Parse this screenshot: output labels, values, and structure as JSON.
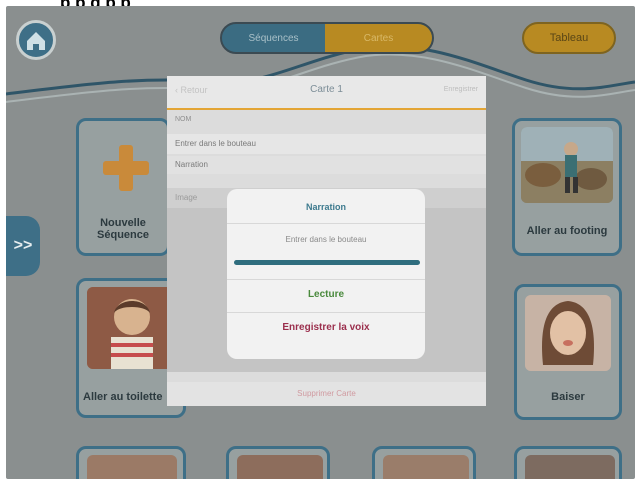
{
  "caption_fragment": "p   p   g   p   p",
  "header": {
    "segment_left": "Séquences",
    "segment_right": "Cartes",
    "right_button": "Tableau"
  },
  "side_tab": {
    "label": ">>"
  },
  "cards": [
    {
      "id": "new-sequence",
      "label": "Nouvelle Séquence"
    },
    {
      "id": "jogging",
      "label": "Aller au footing"
    },
    {
      "id": "school",
      "label": "Aller au toilette"
    },
    {
      "id": "kiss",
      "label": "Baiser"
    }
  ],
  "sheet": {
    "back_label": "Retour",
    "title": "Carte 1",
    "right_label": "Enregistrer",
    "section_nom": "NOM",
    "name_value": "Entrer dans le bouteau",
    "narration_row": "Narration",
    "image_row": "Image",
    "delete_label": "Supprimer Carte"
  },
  "dialog": {
    "title": "Narration",
    "sentence": "Entrer dans le bouteau",
    "progress": 1.0,
    "play_label": "Lecture",
    "record_label": "Enregistrer la voix"
  },
  "colors": {
    "app_background": "#8a8f8f",
    "accent_blue": "#3e6f87",
    "accent_orange": "#b88a22",
    "divider_orange": "#e3a535",
    "play_green": "#4a8a3d",
    "record_red": "#9b2f4d"
  }
}
